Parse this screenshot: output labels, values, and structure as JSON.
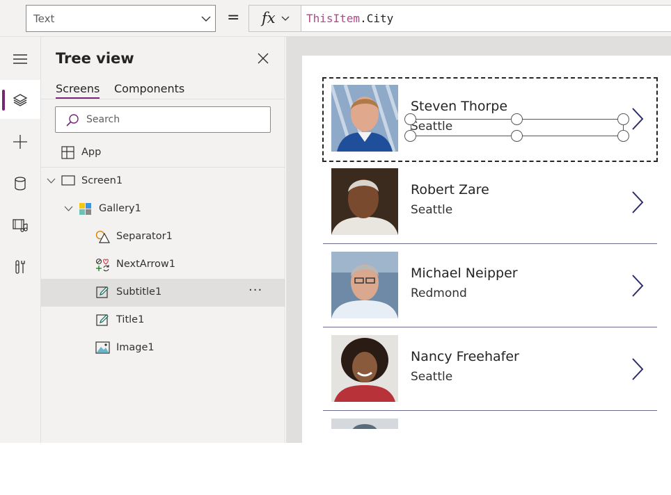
{
  "formula_bar": {
    "property": "Text",
    "equals": "=",
    "fx_label": "fx",
    "formula_object": "ThisItem",
    "formula_rest": ".City"
  },
  "rail": {
    "items": [
      {
        "icon": "hamburger-icon"
      },
      {
        "icon": "layers-icon",
        "active": true
      },
      {
        "icon": "plus-icon"
      },
      {
        "icon": "database-icon"
      },
      {
        "icon": "media-icon"
      },
      {
        "icon": "tools-icon"
      }
    ]
  },
  "tree": {
    "title": "Tree view",
    "tabs": [
      "Screens",
      "Components"
    ],
    "search_placeholder": "Search",
    "app_label": "App",
    "nodes": [
      {
        "label": "Screen1",
        "icon": "screen-icon"
      },
      {
        "label": "Gallery1",
        "icon": "gallery-icon"
      },
      {
        "label": "Separator1",
        "icon": "shapes-icon"
      },
      {
        "label": "NextArrow1",
        "icon": "icons-control-icon"
      },
      {
        "label": "Subtitle1",
        "icon": "edit-label-icon",
        "selected": true
      },
      {
        "label": "Title1",
        "icon": "edit-label-icon"
      },
      {
        "label": "Image1",
        "icon": "image-icon"
      }
    ],
    "more_label": "···"
  },
  "gallery": {
    "items": [
      {
        "name": "Steven Thorpe",
        "city": "Seattle",
        "selected": true
      },
      {
        "name": "Robert Zare",
        "city": "Seattle"
      },
      {
        "name": "Michael Neipper",
        "city": "Redmond"
      },
      {
        "name": "Nancy Freehafer",
        "city": "Seattle"
      }
    ]
  },
  "colors": {
    "accent": "#742774",
    "formula_keyword": "#b2478a",
    "arrow": "#2b2b6b"
  }
}
